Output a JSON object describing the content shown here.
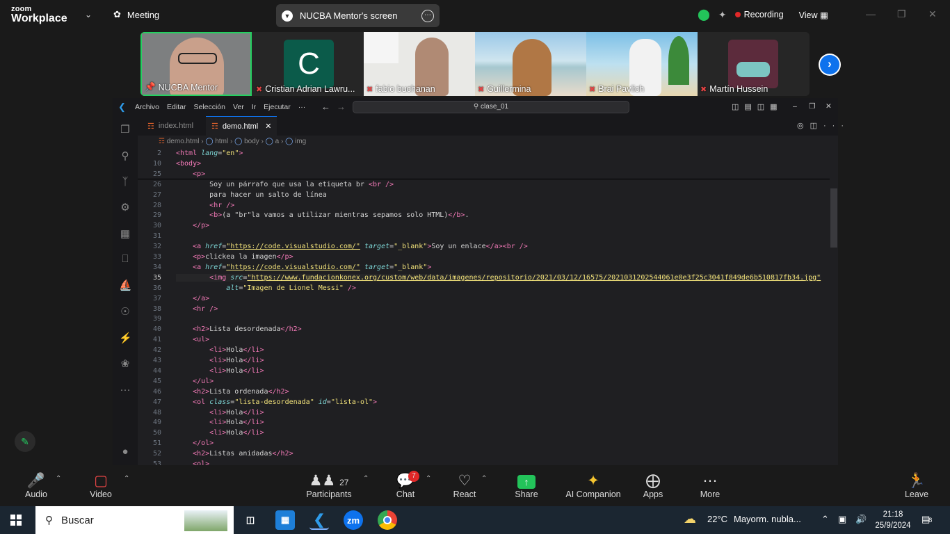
{
  "zoom": {
    "brand_top": "zoom",
    "brand_bottom": "Workplace",
    "meeting_label": "Meeting",
    "share_label": "NUCBA Mentor's screen",
    "recording": "Recording",
    "view": "View"
  },
  "participants": [
    {
      "name": "NUCBA Mentor",
      "active": true
    },
    {
      "name": "Cristian Adrian Lawru...",
      "initial": "C"
    },
    {
      "name": "fabio buchanan"
    },
    {
      "name": "Guillermina"
    },
    {
      "name": "Brai Pavlich"
    },
    {
      "name": "Martín Hussein"
    }
  ],
  "vscode": {
    "menu": [
      "Archivo",
      "Editar",
      "Selección",
      "Ver",
      "Ir",
      "Ejecutar",
      "···"
    ],
    "search": "clase_01",
    "tabs": [
      {
        "label": "index.html"
      },
      {
        "label": "demo.html"
      }
    ],
    "breadcrumb": [
      "demo.html",
      "html",
      "body",
      "a",
      "img"
    ]
  },
  "code_lines": [
    {
      "n": "2",
      "html": "<span class='tg'>&lt;html</span> <span class='at'>lang</span>=<span class='st'>\"en\"</span><span class='tg'>&gt;</span>"
    },
    {
      "n": "10",
      "html": "<span class='tg'>&lt;body&gt;</span>"
    },
    {
      "n": "25",
      "html": "    <span class='tg'>&lt;p&gt;</span>"
    },
    {
      "n": "26",
      "html": "        Soy un párrafo que usa la etiqueta br <span class='tg'>&lt;br /&gt;</span>"
    },
    {
      "n": "27",
      "html": "        para hacer un salto de línea"
    },
    {
      "n": "28",
      "html": "        <span class='tg'>&lt;hr /&gt;</span>"
    },
    {
      "n": "29",
      "html": "        <span class='tg'>&lt;b&gt;</span>(a \"br\"la vamos a utilizar mientras sepamos solo HTML)<span class='tg'>&lt;/b&gt;</span>."
    },
    {
      "n": "30",
      "html": "    <span class='tg'>&lt;/p&gt;</span>"
    },
    {
      "n": "31",
      "html": ""
    },
    {
      "n": "32",
      "html": "    <span class='tg'>&lt;a</span> <span class='at'>href</span>=<span class='ur'>\"https://code.visualstudio.com/\"</span> <span class='at'>target</span>=<span class='st'>\"_blank\"</span><span class='tg'>&gt;</span>Soy un enlace<span class='tg'>&lt;/a&gt;&lt;br /&gt;</span>"
    },
    {
      "n": "33",
      "html": "    <span class='tg'>&lt;p&gt;</span>clickea la imagen<span class='tg'>&lt;/p&gt;</span>"
    },
    {
      "n": "34",
      "html": "    <span class='tg'>&lt;a</span> <span class='at'>href</span>=<span class='ur'>\"https://code.visualstudio.com/\"</span> <span class='at'>target</span>=<span class='st'>\"_blank\"</span><span class='tg'>&gt;</span>"
    },
    {
      "n": "35",
      "html": "        <span class='tg'>&lt;img</span> <span class='at'>src</span>=<span class='ur'>\"https://www.fundacionkonex.org/custom/web/data/imagenes/repositorio/2021/03/12/16575/20210312025440​61e0e3f25c3041f849de6b510817fb34.jpg\"</span>",
      "cur": true
    },
    {
      "n": "36",
      "html": "            <span class='at'>alt</span>=<span class='st'>\"Imagen de Lionel Messi\"</span> <span class='tg'>/&gt;</span>"
    },
    {
      "n": "37",
      "html": "    <span class='tg'>&lt;/a&gt;</span>"
    },
    {
      "n": "38",
      "html": "    <span class='tg'>&lt;hr /&gt;</span>"
    },
    {
      "n": "39",
      "html": ""
    },
    {
      "n": "40",
      "html": "    <span class='tg'>&lt;h2&gt;</span>Lista desordenada<span class='tg'>&lt;/h2&gt;</span>"
    },
    {
      "n": "41",
      "html": "    <span class='tg'>&lt;ul&gt;</span>"
    },
    {
      "n": "42",
      "html": "        <span class='tg'>&lt;li&gt;</span>Hola<span class='tg'>&lt;/li&gt;</span>"
    },
    {
      "n": "43",
      "html": "        <span class='tg'>&lt;li&gt;</span>Hola<span class='tg'>&lt;/li&gt;</span>"
    },
    {
      "n": "44",
      "html": "        <span class='tg'>&lt;li&gt;</span>Hola<span class='tg'>&lt;/li&gt;</span>"
    },
    {
      "n": "45",
      "html": "    <span class='tg'>&lt;/ul&gt;</span>"
    },
    {
      "n": "46",
      "html": "    <span class='tg'>&lt;h2&gt;</span>Lista ordenada<span class='tg'>&lt;/h2&gt;</span>"
    },
    {
      "n": "47",
      "html": "    <span class='tg'>&lt;ol</span> <span class='at'>class</span>=<span class='st'>\"lista-desordenada\"</span> <span class='at'>id</span>=<span class='st'>\"lista-ol\"</span><span class='tg'>&gt;</span>"
    },
    {
      "n": "48",
      "html": "        <span class='tg'>&lt;li&gt;</span>Hola<span class='tg'>&lt;/li&gt;</span>"
    },
    {
      "n": "49",
      "html": "        <span class='tg'>&lt;li&gt;</span>Hola<span class='tg'>&lt;/li&gt;</span>"
    },
    {
      "n": "50",
      "html": "        <span class='tg'>&lt;li&gt;</span>Hola<span class='tg'>&lt;/li&gt;</span>"
    },
    {
      "n": "51",
      "html": "    <span class='tg'>&lt;/ol&gt;</span>"
    },
    {
      "n": "52",
      "html": "    <span class='tg'>&lt;h2&gt;</span>Listas anidadas<span class='tg'>&lt;/h2&gt;</span>"
    },
    {
      "n": "53",
      "html": "    <span class='tg'>&lt;ol&gt;</span>"
    }
  ],
  "toolbar": {
    "audio": "Audio",
    "video": "Video",
    "participants": "Participants",
    "participants_count": "27",
    "chat": "Chat",
    "chat_badge": "7",
    "react": "React",
    "share": "Share",
    "ai": "AI Companion",
    "apps": "Apps",
    "more": "More",
    "leave": "Leave"
  },
  "taskbar": {
    "search": "Buscar",
    "weather_temp": "22°C",
    "weather_text": "Mayorm. nubla...",
    "time": "21:18",
    "date": "25/9/2024",
    "notif": "8",
    "zm": "zm"
  }
}
